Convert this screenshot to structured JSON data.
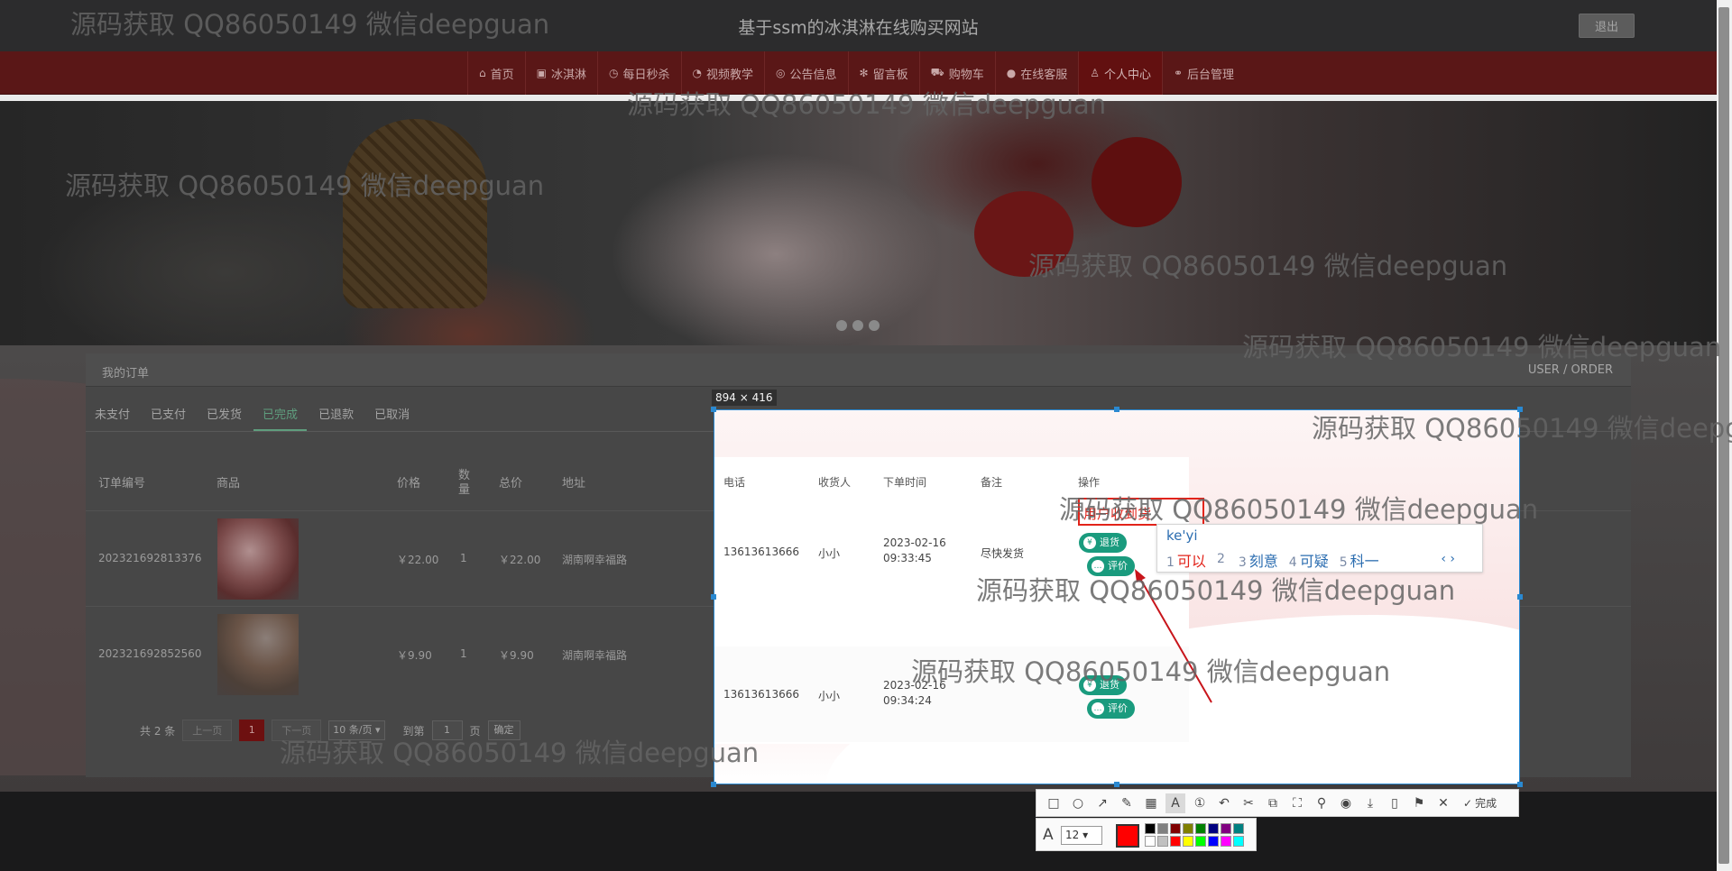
{
  "header": {
    "site_title": "基于ssm的冰淇淋在线购买网站",
    "logout_label": "退出"
  },
  "nav": {
    "items": [
      {
        "label": "首页",
        "icon": "home-icon",
        "glyph": "⌂"
      },
      {
        "label": "冰淇淋",
        "icon": "gift-icon",
        "glyph": "▣"
      },
      {
        "label": "每日秒杀",
        "icon": "clock-icon",
        "glyph": "◷"
      },
      {
        "label": "视频教学",
        "icon": "dashboard-icon",
        "glyph": "◔"
      },
      {
        "label": "公告信息",
        "icon": "broadcast-icon",
        "glyph": "◎"
      },
      {
        "label": "留言板",
        "icon": "snowflake-icon",
        "glyph": "✻"
      },
      {
        "label": "购物车",
        "icon": "cart-icon",
        "glyph": "⛟"
      },
      {
        "label": "在线客服",
        "icon": "chat-icon",
        "glyph": "●"
      },
      {
        "label": "个人中心",
        "icon": "user-icon",
        "glyph": "♙"
      },
      {
        "label": "后台管理",
        "icon": "link-icon",
        "glyph": "⚭"
      }
    ],
    "active_index": 8
  },
  "orders": {
    "title": "我的订单",
    "crumb": "USER / ORDER",
    "tabs": [
      "未支付",
      "已支付",
      "已发货",
      "已完成",
      "已退款",
      "已取消"
    ],
    "active_tab": "已完成",
    "columns": {
      "order_no": "订单编号",
      "product": "商品",
      "price": "价格",
      "qty_top": "数",
      "qty_bottom": "量",
      "total": "总价",
      "address": "地址",
      "phone": "电话",
      "receiver": "收货人",
      "order_time": "下单时间",
      "remark": "备注",
      "actions": "操作"
    },
    "rows": [
      {
        "order_no": "202321692813376",
        "price": "￥22.00",
        "qty": "1",
        "total": "￥22.00",
        "address": "湖南啊幸福路",
        "phone": "13613613666",
        "receiver": "小小",
        "date": "2023-02-16",
        "time": "09:33:45",
        "remark": "尽快发货"
      },
      {
        "order_no": "202321692852560",
        "price": "￥9.90",
        "qty": "1",
        "total": "￥9.90",
        "address": "湖南啊幸福路",
        "phone": "13613613666",
        "receiver": "小小",
        "date": "2023-02-16",
        "time": "09:34:24",
        "remark": ""
      }
    ],
    "action_refund": "退货",
    "action_review": "评价",
    "refund_glyph": "¥",
    "review_glyph": "…",
    "pager": {
      "total": "共 2 条",
      "prev": "上一页",
      "current": "1",
      "next": "下一页",
      "page_size": "10 条/页",
      "goto": "到第",
      "goto_value": "1",
      "page_unit": "页",
      "confirm": "确定"
    }
  },
  "capture": {
    "size_label": "894 × 416",
    "annotation_text": "用户收到货",
    "ime_input": "ke'yi",
    "ime_candidates": [
      {
        "n": "1",
        "text": "可以"
      },
      {
        "n": "2",
        "text": ""
      },
      {
        "n": "3",
        "text": "刻意"
      },
      {
        "n": "4",
        "text": "可疑"
      },
      {
        "n": "5",
        "text": "科一"
      }
    ],
    "ime_arrows": "‹ ›"
  },
  "toolbar": {
    "tools": [
      {
        "name": "rectangle-tool-icon",
        "glyph": "□"
      },
      {
        "name": "ellipse-tool-icon",
        "glyph": "○"
      },
      {
        "name": "arrow-tool-icon",
        "glyph": "↗"
      },
      {
        "name": "pen-tool-icon",
        "glyph": "✎"
      },
      {
        "name": "mosaic-tool-icon",
        "glyph": "▦"
      },
      {
        "name": "text-tool-icon",
        "glyph": "A"
      },
      {
        "name": "number-tool-icon",
        "glyph": "①"
      },
      {
        "name": "undo-icon",
        "glyph": "↶"
      },
      {
        "name": "scissors-icon",
        "glyph": "✂"
      },
      {
        "name": "translate-icon",
        "glyph": "⧉"
      },
      {
        "name": "ocr-icon",
        "glyph": "⛶"
      },
      {
        "name": "pin-icon",
        "glyph": "⚲"
      },
      {
        "name": "record-icon",
        "glyph": "◉"
      },
      {
        "name": "download-icon",
        "glyph": "⤓"
      },
      {
        "name": "phone-icon",
        "glyph": "▯"
      },
      {
        "name": "bookmark-icon",
        "glyph": "⚑"
      },
      {
        "name": "close-icon",
        "glyph": "✕"
      }
    ],
    "active_tool_index": 5,
    "done_label": "完成",
    "done_glyph": "✓",
    "text_glyph": "A",
    "font_size": "12",
    "current_color": "#ff0000",
    "swatches": [
      "#000000",
      "#808080",
      "#800000",
      "#808000",
      "#008000",
      "#000080",
      "#800080",
      "#008080",
      "#ffffff",
      "#c0c0c0",
      "#ff0000",
      "#ffff00",
      "#00ff00",
      "#0000ff",
      "#ff00ff",
      "#00ffff"
    ]
  },
  "watermark": "源码获取 QQ86050149 微信deepguan"
}
